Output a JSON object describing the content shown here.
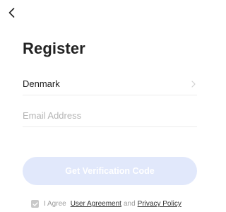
{
  "nav": {
    "back_icon": "chevron-left-icon"
  },
  "page": {
    "title": "Register"
  },
  "form": {
    "region_value": "Denmark",
    "region_chevron_icon": "chevron-right-icon",
    "email_placeholder": "Email Address",
    "email_value": ""
  },
  "actions": {
    "verify_label": "Get Verification Code",
    "verify_disabled": true
  },
  "agreement": {
    "checked": true,
    "prefix": "I Agree",
    "user_agreement": "User Agreement",
    "joiner": "and",
    "privacy_policy": "Privacy Policy"
  },
  "colors": {
    "button_bg_disabled": "#e1e8fb",
    "title_text": "#222222",
    "muted_text": "#9b9b9b",
    "placeholder_text": "#b5b5b5"
  }
}
